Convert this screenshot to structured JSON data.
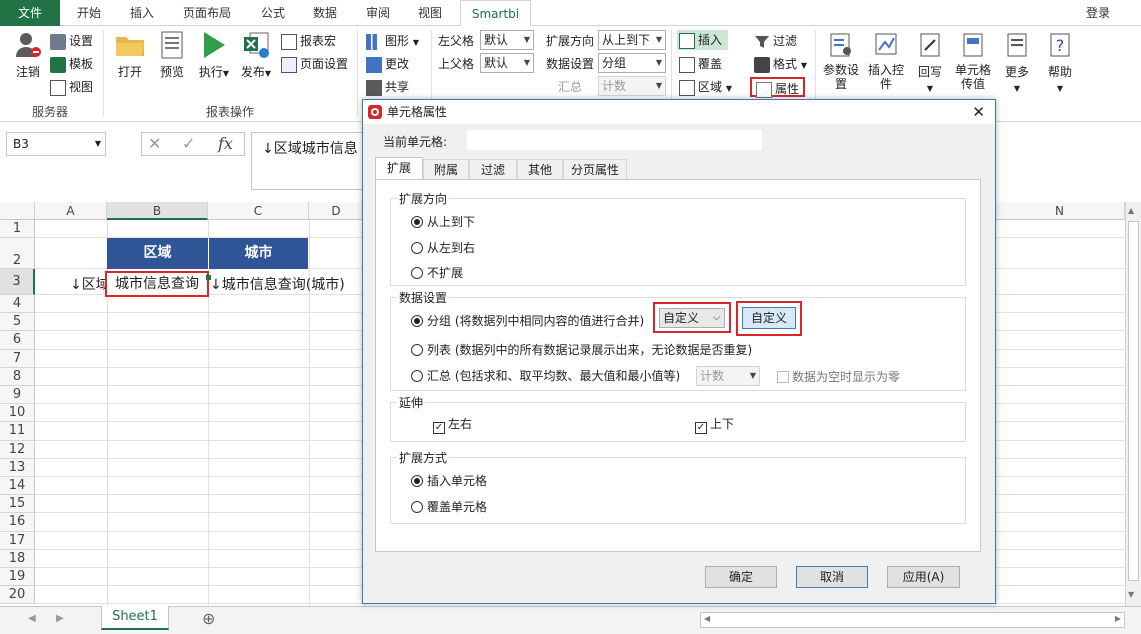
{
  "tabs": [
    "文件",
    "开始",
    "插入",
    "页面布局",
    "公式",
    "数据",
    "审阅",
    "视图",
    "Smartbi"
  ],
  "login": "登录",
  "ribbon": {
    "server": {
      "logout": "注销",
      "settings": "设置",
      "template": "模板",
      "view": "视图",
      "group": "服务器"
    },
    "report": {
      "open": "打开",
      "preview": "预览",
      "execute": "执行",
      "publish": "发布",
      "macro": "报表宏",
      "page_setup": "页面设置",
      "group": "报表操作"
    },
    "tools": {
      "shape": "图形",
      "change": "更改",
      "share": "共享"
    },
    "header": {
      "left_label": "左父格",
      "left_val": "默认",
      "up_label": "上父格",
      "up_val": "默认"
    },
    "expand": {
      "dir_label": "扩展方向",
      "dir_val": "从上到下",
      "data_label": "数据设置",
      "data_val": "分组",
      "sum_label": "汇总",
      "sum_val": "计数"
    },
    "cell": {
      "insert": "插入",
      "cover": "覆盖",
      "area": "区域",
      "filter": "过滤",
      "format": "格式",
      "props": "属性"
    },
    "big": {
      "param": "参数设置",
      "insert_ctrl": "插入控件",
      "writeback": "回写",
      "cell_val": "单元格传值",
      "more": "更多",
      "help": "帮助"
    }
  },
  "namebox": "B3",
  "formula": "↓区域城市信息",
  "grid": {
    "cols": [
      "A",
      "B",
      "C",
      "D",
      "N"
    ],
    "rows": [
      "1",
      "2",
      "3",
      "4",
      "5",
      "6",
      "7",
      "8",
      "9",
      "10",
      "11",
      "12",
      "13",
      "14",
      "15",
      "16",
      "17",
      "18",
      "19",
      "20"
    ],
    "b2": "区域",
    "c2": "城市",
    "a3": "↓区域",
    "b3": "城市信息查询",
    "c3": "↓城市信息查询(城市)"
  },
  "sheet": {
    "name": "Sheet1",
    "add": "⊕"
  },
  "dialog": {
    "title": "单元格属性",
    "current_cell_label": "当前单元格:",
    "tabs": [
      "扩展",
      "附属",
      "过滤",
      "其他",
      "分页属性"
    ],
    "dir_group": "扩展方向",
    "dir_opts": [
      "从上到下",
      "从左到右",
      "不扩展"
    ],
    "data_group": "数据设置",
    "group_opt": "分组 (将数据列中相同内容的值进行合并)",
    "group_select": "自定义",
    "group_btn": "自定义",
    "list_opt": "列表 (数据列中的所有数据记录展示出来，无论数据是否重复)",
    "sum_opt": "汇总 (包括求和、取平均数、最大值和最小值等)",
    "sum_select": "计数",
    "zero_chk": "数据为空时显示为零",
    "ext_group": "延伸",
    "ext_lr": "左右",
    "ext_ud": "上下",
    "mode_group": "扩展方式",
    "mode_opts": [
      "插入单元格",
      "覆盖单元格"
    ],
    "ok": "确定",
    "cancel": "取消",
    "apply": "应用(A)"
  }
}
